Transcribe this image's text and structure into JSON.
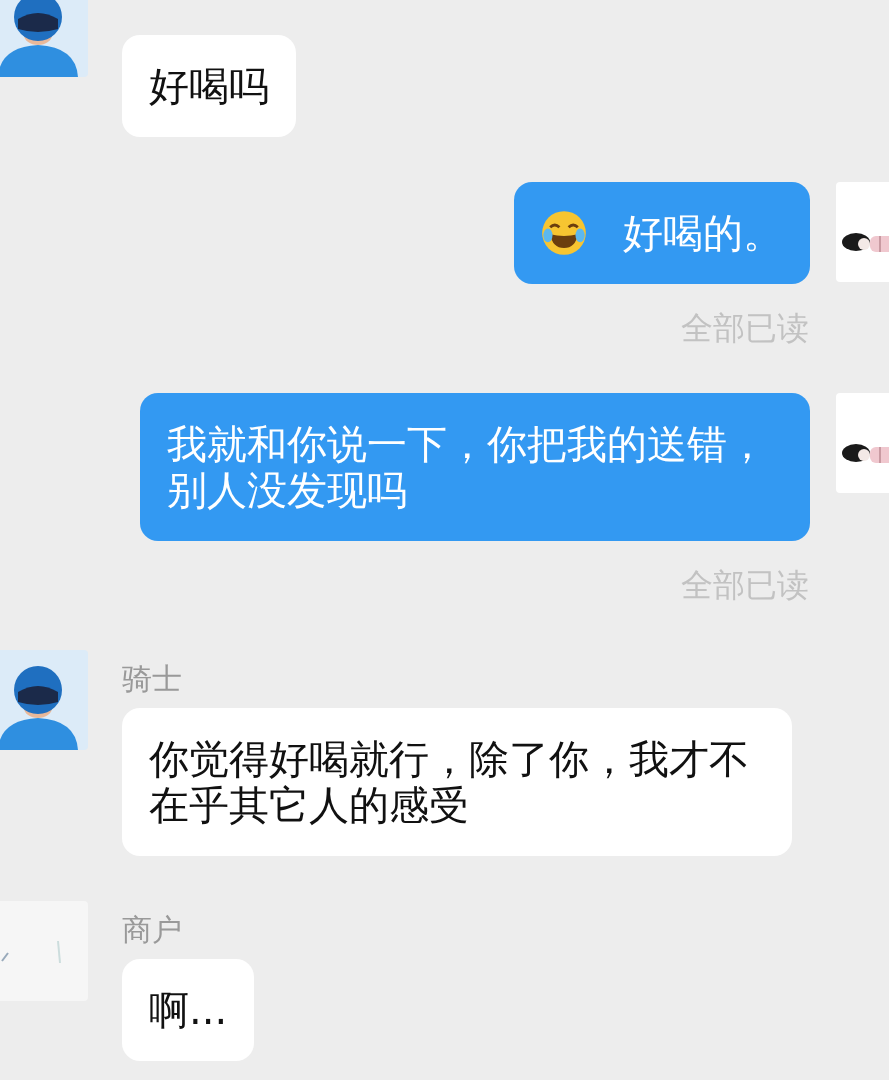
{
  "messages": [
    {
      "kind": "received",
      "avatar": {
        "kind": "rider"
      },
      "text": "好喝吗"
    },
    {
      "kind": "sent",
      "avatar": {
        "kind": "figure"
      },
      "emoji": true,
      "text": "好喝的。",
      "receipt": "全部已读"
    },
    {
      "kind": "sent",
      "avatar": {
        "kind": "figure"
      },
      "emoji": false,
      "text": "我就和你说一下，你把我的送错，别人没发现吗",
      "receipt": "全部已读"
    },
    {
      "kind": "received",
      "avatar": {
        "kind": "rider"
      },
      "sender": "骑士",
      "text": "你觉得好喝就行，除了你，我才不在乎其它人的感受"
    },
    {
      "kind": "received",
      "avatar": {
        "kind": "merchant"
      },
      "sender": "商户",
      "text": "啊..."
    }
  ]
}
